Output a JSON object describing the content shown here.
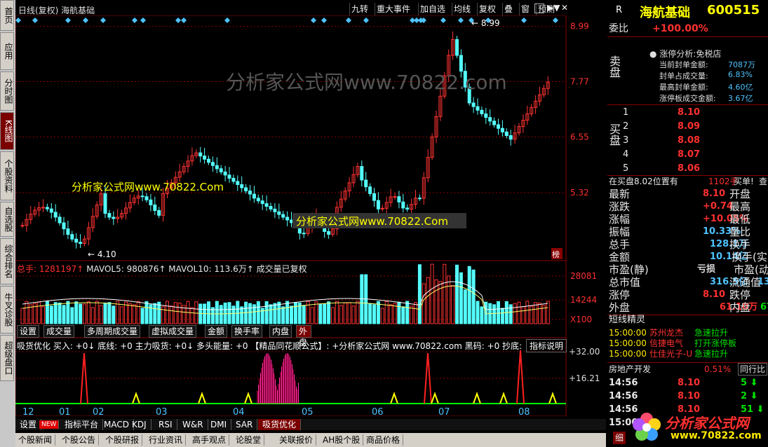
{
  "colors": {
    "up": "#ff3232",
    "down": "#54ffff",
    "bg": "#000000",
    "grid": "#8b0000",
    "accent": "#c00000"
  },
  "left_nav": [
    "首页",
    "应用",
    "分时图",
    "K线图",
    "个股资料",
    "自选股",
    "综合排名",
    "牛叉诊股",
    "超级盘口"
  ],
  "toolbar": {
    "title": "日线(复权)  海航基础",
    "buttons": [
      "九转",
      "重大事件",
      "加自选",
      "均线",
      "复权",
      "叠",
      "窗",
      "预测"
    ]
  },
  "price_chart": {
    "y_ticks": [
      "8.99",
      "7.77",
      "6.55",
      "5.32"
    ],
    "high_label": "8.99",
    "low_label": "4.10",
    "badge": "榜",
    "watermark": "分析家公式网www.70822.com",
    "overlay1": "分析家公式网www.70822.Com",
    "overlay2": "分析家公式网www.70822.Com"
  },
  "volume_chart": {
    "label_total": "总手: 1281197↑",
    "label_ma5": "MAVOL5: 980876↑",
    "label_ma10": "MAVOL10: 113.6万↑",
    "label_note": "成交量已复权",
    "y_ticks": [
      "28081",
      "14244",
      "X100"
    ],
    "tabs": [
      "设置",
      "成交量",
      "多周期成交量",
      "虚拟成交量",
      "金额",
      "换手率",
      "内盘",
      "外盘"
    ]
  },
  "indicator_chart": {
    "label": "吸货优化 买入: +0↓ 底线: +0 主力吸货: +0↓ 多头能量: +0 【精品同花顺公式】: +分析家公式网 www.70822.com 黑码: +0 抄底: +0 卖出: +0",
    "help": "指标说明",
    "y_ticks": [
      "+32.00",
      "+16.21"
    ],
    "x_ticks": [
      "12",
      "01",
      "02",
      "03",
      "04",
      "05",
      "06",
      "07",
      "08"
    ]
  },
  "bottom_tabs": [
    "设置",
    "NEW",
    "指标平台",
    "MACD",
    "KDJ",
    "RSI",
    "W&R",
    "DMI",
    "SAR",
    "吸货优化"
  ],
  "bottom_tabs2": [
    "个股新闻",
    "个股公告",
    "个股研报",
    "行业资讯",
    "高手观点",
    "论股堂",
    "关联报价",
    "AH股个股",
    "商品价格"
  ],
  "right_panel": {
    "flag": "R",
    "stock_name": "海航基础",
    "stock_code": "600515",
    "weibi_label": "委比",
    "weibi_value": "+100.00%",
    "zt_title": "涨停分析:",
    "zt_sub": "免税店",
    "zt_items": [
      [
        "当前封单金额:",
        "7087万"
      ],
      [
        "封单占成交量:",
        "6.83%"
      ],
      [
        "最高封单金额:",
        "4.60亿"
      ],
      [
        "涨停板成交金额:",
        "3.67亿"
      ]
    ],
    "sell_label": "卖盘",
    "buy_label": "买盘",
    "bids": [
      [
        "1",
        "8.10"
      ],
      [
        "2",
        "8.09"
      ],
      [
        "3",
        "8.08"
      ],
      [
        "4",
        "8.07"
      ],
      [
        "5",
        "8.06"
      ]
    ],
    "position_text": "在买盘8.02位置有",
    "position_qty": "1102手",
    "position_tail": "买单!",
    "position_more": "查",
    "quotes": [
      [
        "最新",
        "8.10",
        "开盘",
        ""
      ],
      [
        "涨跌",
        "+0.74",
        "最高",
        ""
      ],
      [
        "涨幅",
        "+10.05%",
        "最低",
        ""
      ],
      [
        "振幅",
        "10.33%",
        "量比",
        ""
      ],
      [
        "总手",
        "128.1万",
        "换手",
        ""
      ],
      [
        "金额",
        "10.14亿",
        "换手(实)",
        ""
      ],
      [
        "市盈(静)",
        "亏损",
        "市盈(动)",
        ""
      ],
      [
        "总市值",
        "316.5亿",
        "流通值",
        "13"
      ],
      [
        "涨停",
        "8.10",
        "跌停",
        ""
      ],
      [
        "外盘",
        "61.10万",
        "内盘",
        "67"
      ]
    ],
    "elf_title": "短线精灵",
    "elf": [
      [
        "15:00:00",
        "苏州龙杰",
        "急速拉升"
      ],
      [
        "15:00:00",
        "信捷电气",
        "打开涨停板"
      ],
      [
        "15:00:00",
        "仕佳光子-U",
        "急速拉升"
      ]
    ],
    "sector": {
      "name": "房地产开发",
      "pct": "0.51%",
      "btn": "同行比"
    },
    "ticks": [
      [
        "14:56",
        "8.10",
        "5"
      ],
      [
        "14:56",
        "8.10",
        "2"
      ],
      [
        "14:56",
        "8.10",
        "51"
      ],
      [
        "15:00",
        "",
        ""
      ]
    ],
    "detail_btn": "细"
  },
  "logo": {
    "text": "分析家公式网",
    "url": "www.70822.com"
  }
}
